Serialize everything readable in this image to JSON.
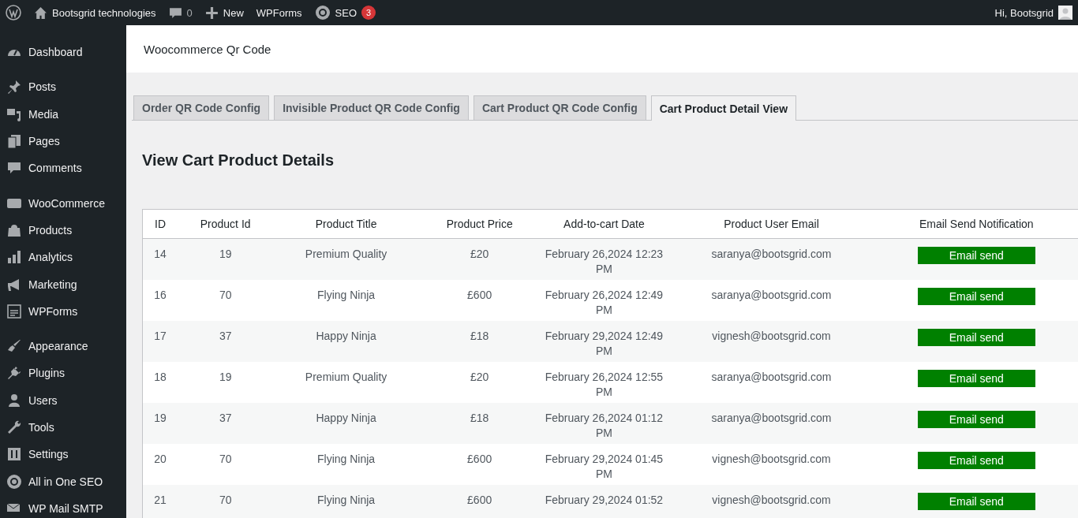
{
  "admin_bar": {
    "site": "Bootsgrid technologies",
    "comments": "0",
    "new": "New",
    "wpforms": "WPForms",
    "seo": "SEO",
    "seo_badge": "3",
    "greeting": "Hi, Bootsgrid"
  },
  "sidebar": {
    "groups": [
      [
        {
          "label": "Dashboard"
        }
      ],
      [
        {
          "label": "Posts"
        },
        {
          "label": "Media"
        },
        {
          "label": "Pages"
        },
        {
          "label": "Comments"
        }
      ],
      [
        {
          "label": "WooCommerce"
        },
        {
          "label": "Products"
        },
        {
          "label": "Analytics"
        },
        {
          "label": "Marketing"
        },
        {
          "label": "WPForms"
        }
      ],
      [
        {
          "label": "Appearance"
        },
        {
          "label": "Plugins"
        },
        {
          "label": "Users"
        },
        {
          "label": "Tools"
        },
        {
          "label": "Settings"
        },
        {
          "label": "All in One SEO"
        },
        {
          "label": "WP Mail SMTP"
        }
      ]
    ]
  },
  "page_title": "Woocommerce Qr Code",
  "tabs": [
    {
      "label": "Order QR Code Config",
      "selected": false
    },
    {
      "label": "Invisible Product QR Code Config",
      "selected": false
    },
    {
      "label": "Cart Product QR Code Config",
      "selected": false
    },
    {
      "label": "Cart Product Detail View",
      "selected": true
    }
  ],
  "heading": "View Cart Product Details",
  "table": {
    "columns": [
      "ID",
      "Product Id",
      "Product Title",
      "Product Price",
      "Add-to-cart Date",
      "Product User Email",
      "Email Send Notification"
    ],
    "rows": [
      {
        "id": "14",
        "product_id": "19",
        "title": "Premium Quality",
        "price": "£20",
        "date": "February 26,2024 12:23 PM",
        "email": "saranya@bootsgrid.com",
        "action": "Email send"
      },
      {
        "id": "16",
        "product_id": "70",
        "title": "Flying Ninja",
        "price": "£600",
        "date": "February 26,2024 12:49 PM",
        "email": "saranya@bootsgrid.com",
        "action": "Email send"
      },
      {
        "id": "17",
        "product_id": "37",
        "title": "Happy Ninja",
        "price": "£18",
        "date": "February 29,2024 12:49 PM",
        "email": "vignesh@bootsgrid.com",
        "action": "Email send"
      },
      {
        "id": "18",
        "product_id": "19",
        "title": "Premium Quality",
        "price": "£20",
        "date": "February 26,2024 12:55 PM",
        "email": "saranya@bootsgrid.com",
        "action": "Email send"
      },
      {
        "id": "19",
        "product_id": "37",
        "title": "Happy Ninja",
        "price": "£18",
        "date": "February 26,2024 01:12 PM",
        "email": "saranya@bootsgrid.com",
        "action": "Email send"
      },
      {
        "id": "20",
        "product_id": "70",
        "title": "Flying Ninja",
        "price": "£600",
        "date": "February 29,2024 01:45 PM",
        "email": "vignesh@bootsgrid.com",
        "action": "Email send"
      },
      {
        "id": "21",
        "product_id": "70",
        "title": "Flying Ninja",
        "price": "£600",
        "date": "February 29,2024 01:52",
        "email": "vignesh@bootsgrid.com",
        "action": "Email send"
      }
    ]
  }
}
